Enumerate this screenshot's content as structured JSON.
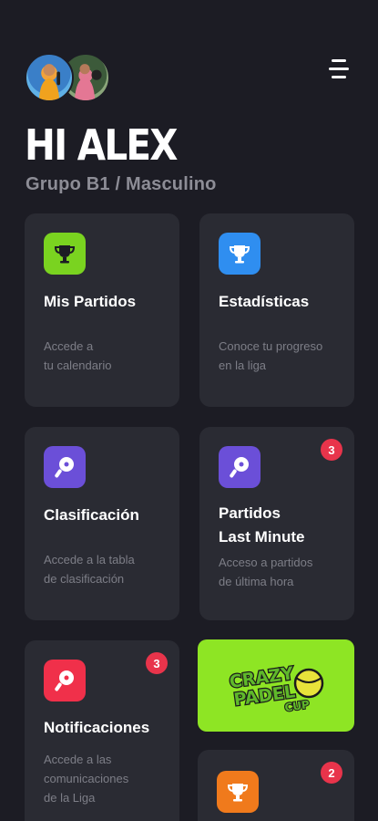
{
  "header": {
    "greeting": "HI ALEX",
    "group": "Grupo B1 / Masculino"
  },
  "colors": {
    "background": "#1c1c24",
    "card": "#2a2b33",
    "green_icon": "#7ad320",
    "blue_icon": "#2f8ef0",
    "purple_icon": "#6b4fd8",
    "red_icon": "#f0304a",
    "orange_icon": "#f07a1c",
    "badge": "#e8344b",
    "banner": "#8ee524"
  },
  "cards": {
    "partidos": {
      "title": "Mis Partidos",
      "desc_1": "Accede a",
      "desc_2": "tu calendario",
      "icon": "trophy-icon"
    },
    "estadisticas": {
      "title": "Estadísticas",
      "desc_1": "Conoce tu progreso",
      "desc_2": "en la liga",
      "icon": "trophy-icon"
    },
    "clasificacion": {
      "title": "Clasificación",
      "desc_1": "Accede a la tabla",
      "desc_2": "de clasificación",
      "icon": "padel-racket-icon"
    },
    "last_minute": {
      "title_1": "Partidos",
      "title_2": "Last Minute",
      "desc_1": "Acceso a partidos",
      "desc_2": "de última hora",
      "icon": "padel-racket-icon",
      "badge": "3"
    },
    "notificaciones": {
      "title": "Notificaciones",
      "desc_1": "Accede a las",
      "desc_2": "comunicaciones",
      "desc_3": "de la Liga",
      "icon": "padel-racket-icon",
      "badge": "3"
    },
    "extra": {
      "icon": "trophy-icon",
      "badge": "2"
    }
  },
  "banner": {
    "line_1": "CRAZY",
    "line_2": "PADEL",
    "line_3": "CUP"
  }
}
